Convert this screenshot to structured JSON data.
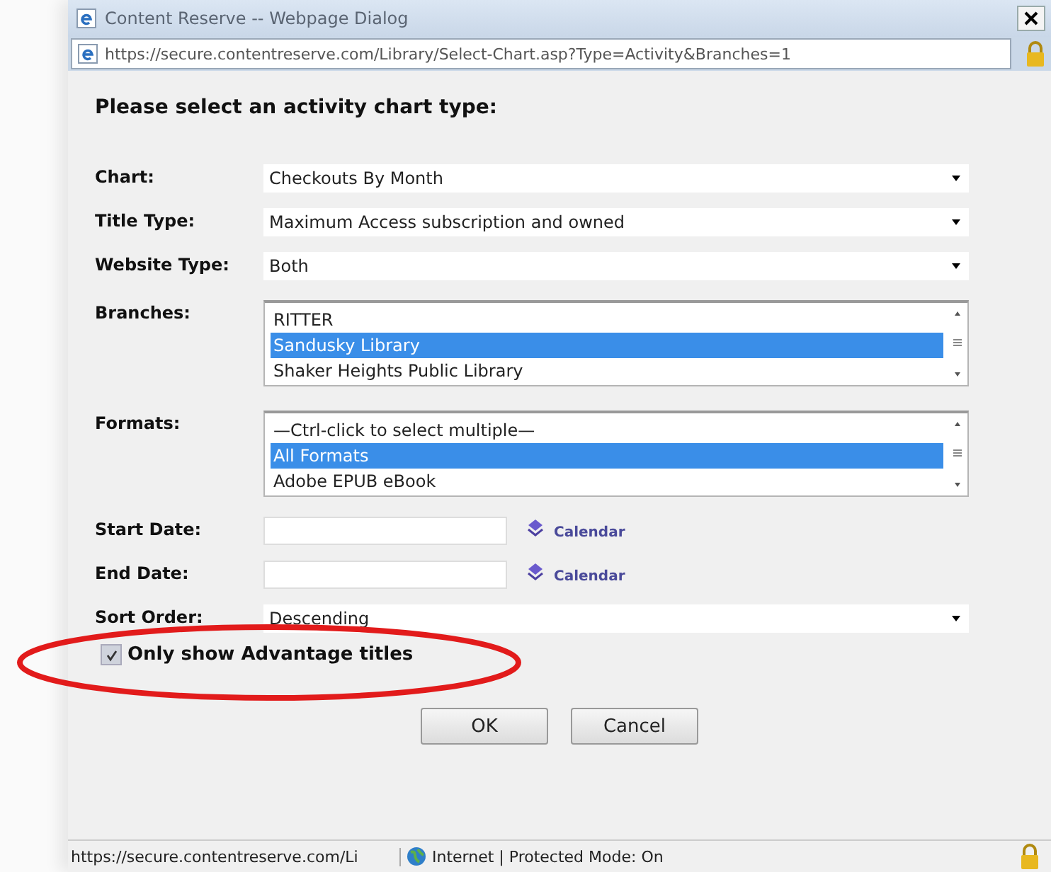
{
  "window": {
    "title": "Content Reserve -- Webpage Dialog",
    "url": "https://secure.contentreserve.com/Library/Select-Chart.asp?Type=Activity&Branches=1"
  },
  "heading": "Please select an activity chart type:",
  "fields": [
    {
      "kind": "select",
      "label": "Chart:",
      "value": "Checkouts By Month"
    },
    {
      "kind": "select",
      "label": "Title Type:",
      "value": "Maximum Access subscription and owned"
    },
    {
      "kind": "select",
      "label": "Website Type:",
      "value": "Both"
    },
    {
      "kind": "listbox",
      "label": "Branches:",
      "items": [
        {
          "text": "RITTER",
          "selected": false
        },
        {
          "text": "Sandusky Library",
          "selected": true
        },
        {
          "text": "Shaker Heights Public Library",
          "selected": false
        }
      ]
    },
    {
      "kind": "listbox",
      "label": "Formats:",
      "items": [
        {
          "text": "—Ctrl-click to select multiple—",
          "selected": false
        },
        {
          "text": "All Formats",
          "selected": true
        },
        {
          "text": "Adobe EPUB eBook",
          "selected": false
        }
      ]
    },
    {
      "kind": "date",
      "label": "Start Date:",
      "link": "Calendar"
    },
    {
      "kind": "date",
      "label": "End Date:",
      "link": "Calendar"
    },
    {
      "kind": "select",
      "label": "Sort Order:",
      "value": "Descending"
    }
  ],
  "checkbox": {
    "label": "Only show Advantage titles",
    "checked": true
  },
  "buttons": [
    "OK",
    "Cancel"
  ],
  "status_bar": {
    "url": "https://secure.contentreserve.com/Li",
    "zone": "Internet | Protected Mode: On"
  }
}
